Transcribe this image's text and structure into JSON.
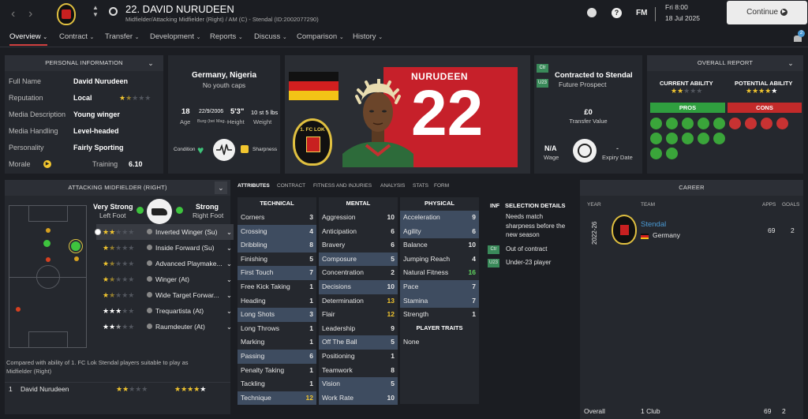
{
  "header": {
    "player_title": "22. DAVID NURUDEEN",
    "player_sub": "Midfielder/Attacking Midfielder (Right) / AM (C) - Stendal (ID:2002077290)",
    "date_day": "Fri 8:00",
    "date": "18 Jul 2025",
    "continue_label": "Continue",
    "fm_label": "FM",
    "help_label": "?",
    "notif_count": "2"
  },
  "nav": [
    "Overview",
    "Contract",
    "Transfer",
    "Development",
    "Reports",
    "Discuss",
    "Comparison",
    "History"
  ],
  "personal": {
    "title": "PERSONAL INFORMATION",
    "rows": [
      {
        "label": "Full Name",
        "value": "David Nurudeen"
      },
      {
        "label": "Reputation",
        "value": "Local"
      },
      {
        "label": "Media Description",
        "value": "Young winger"
      },
      {
        "label": "Media Handling",
        "value": "Level-headed"
      },
      {
        "label": "Personality",
        "value": "Fairly Sporting"
      }
    ],
    "reputation_stars": 1.5,
    "morale_label": "Morale",
    "training_label": "Training",
    "training_value": "6.10"
  },
  "bio": {
    "nationality": "Germany, Nigeria",
    "youth_caps": "No youth caps",
    "age": "18",
    "age_label": "Age",
    "dob": "22/9/2006",
    "dob_sub": "Burg (bei Mag...",
    "height": "5'3\"",
    "height_label": "Height",
    "weight": "10 st 5 lbs",
    "weight_label": "Weight",
    "condition_label": "Condition",
    "sharpness_label": "Sharpness"
  },
  "shirt": {
    "name": "NURUDEEN",
    "number": "22"
  },
  "club_badge_text": "1. FC LOK",
  "contract": {
    "ctr_tag": "Ctr",
    "u23_tag": "U23",
    "title": "Contracted to Stendal",
    "subtitle": "Future Prospect",
    "transfer_value": "£0",
    "transfer_value_label": "Transfer Value",
    "wage": "N/A",
    "wage_label": "Wage",
    "expiry": "-",
    "expiry_label": "Expiry Date"
  },
  "report": {
    "title": "OVERALL REPORT",
    "current_label": "CURRENT ABILITY",
    "potential_label": "POTENTIAL ABILITY",
    "current_stars": 2,
    "potential_stars": 4.5,
    "pros_label": "PROS",
    "cons_label": "CONS"
  },
  "roles": {
    "title": "ATTACKING MIDFIELDER (RIGHT)",
    "weak_foot_label": "Very Strong",
    "weak_foot_side": "Left Foot",
    "strong_foot_label": "Strong",
    "strong_foot_side": "Right Foot",
    "list": [
      {
        "stars": 2,
        "name": "Inverted Winger (Su)"
      },
      {
        "stars": 1.5,
        "name": "Inside Forward (Su)"
      },
      {
        "stars": 1.5,
        "name": "Advanced Playmake..."
      },
      {
        "stars": 1.5,
        "name": "Winger (At)"
      },
      {
        "stars": 1.5,
        "name": "Wide Target Forwar..."
      },
      {
        "stars": 3,
        "name": "Trequartista (At)"
      },
      {
        "stars": 2.5,
        "name": "Raumdeuter (At)"
      }
    ],
    "compare_text": "Compared with ability of 1. FC Lok Stendal players suitable to play as Midfielder (Right)",
    "compare_rank": "1",
    "compare_name": "David Nurudeen"
  },
  "tabs": [
    "ATTRIBUTES",
    "CONTRACT",
    "FITNESS AND INJURIES",
    "ANALYSIS",
    "STATS",
    "FORM"
  ],
  "technical": {
    "title": "TECHNICAL",
    "items": [
      {
        "name": "Corners",
        "value": "3"
      },
      {
        "name": "Crossing",
        "value": "4"
      },
      {
        "name": "Dribbling",
        "value": "8"
      },
      {
        "name": "Finishing",
        "value": "5"
      },
      {
        "name": "First Touch",
        "value": "7"
      },
      {
        "name": "Free Kick Taking",
        "value": "1"
      },
      {
        "name": "Heading",
        "value": "1"
      },
      {
        "name": "Long Shots",
        "value": "3"
      },
      {
        "name": "Long Throws",
        "value": "1"
      },
      {
        "name": "Marking",
        "value": "1"
      },
      {
        "name": "Passing",
        "value": "6"
      },
      {
        "name": "Penalty Taking",
        "value": "1"
      },
      {
        "name": "Tackling",
        "value": "1"
      },
      {
        "name": "Technique",
        "value": "12"
      }
    ]
  },
  "mental": {
    "title": "MENTAL",
    "items": [
      {
        "name": "Aggression",
        "value": "10"
      },
      {
        "name": "Anticipation",
        "value": "6"
      },
      {
        "name": "Bravery",
        "value": "6"
      },
      {
        "name": "Composure",
        "value": "5"
      },
      {
        "name": "Concentration",
        "value": "2"
      },
      {
        "name": "Decisions",
        "value": "10"
      },
      {
        "name": "Determination",
        "value": "13"
      },
      {
        "name": "Flair",
        "value": "12"
      },
      {
        "name": "Leadership",
        "value": "9"
      },
      {
        "name": "Off The Ball",
        "value": "5"
      },
      {
        "name": "Positioning",
        "value": "1"
      },
      {
        "name": "Teamwork",
        "value": "8"
      },
      {
        "name": "Vision",
        "value": "5"
      },
      {
        "name": "Work Rate",
        "value": "10"
      }
    ]
  },
  "physical": {
    "title": "PHYSICAL",
    "items": [
      {
        "name": "Acceleration",
        "value": "9"
      },
      {
        "name": "Agility",
        "value": "6"
      },
      {
        "name": "Balance",
        "value": "10"
      },
      {
        "name": "Jumping Reach",
        "value": "4"
      },
      {
        "name": "Natural Fitness",
        "value": "16"
      },
      {
        "name": "Pace",
        "value": "7"
      },
      {
        "name": "Stamina",
        "value": "7"
      },
      {
        "name": "Strength",
        "value": "1"
      }
    ]
  },
  "traits": {
    "title": "PLAYER TRAITS",
    "value": "None"
  },
  "selection": {
    "inf_label": "INF",
    "title": "SELECTION DETAILS",
    "items": [
      {
        "tag": "",
        "text": "Needs match sharpness before the new season"
      },
      {
        "tag": "Ctr",
        "text": "Out of contract"
      },
      {
        "tag": "U23",
        "text": "Under-23 player"
      }
    ]
  },
  "career": {
    "title": "CAREER",
    "col_year": "YEAR",
    "col_team": "TEAM",
    "col_apps": "APPS",
    "col_goals": "GOALS",
    "season": "2022-26",
    "team": "Stendal",
    "country": "Germany",
    "apps": "69",
    "goals": "2",
    "overall_label": "Overall",
    "overall_clubs": "1 Club",
    "overall_apps": "69",
    "overall_goals": "2"
  },
  "colors": {
    "accent": "#d04040",
    "highlight": "#3e4c60",
    "green": "#3aa53a",
    "red": "#c83232",
    "star": "#f2c62f"
  }
}
